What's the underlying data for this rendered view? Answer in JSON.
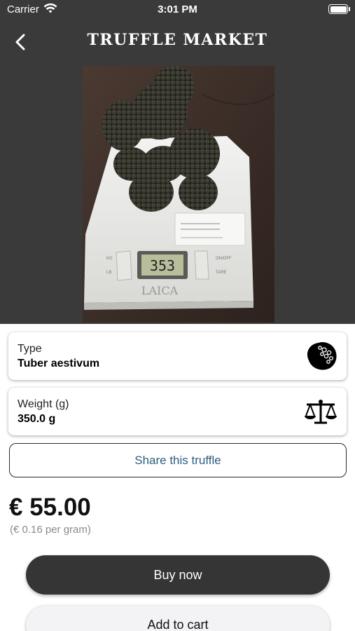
{
  "status_bar": {
    "carrier": "Carrier",
    "time": "3:01 PM",
    "icons": [
      "wifi-icon",
      "battery-icon"
    ]
  },
  "nav": {
    "title": "TRUFFLE MARKET",
    "back_icon": "chevron-left-icon"
  },
  "photo": {
    "scale_brand": "LAICA",
    "scale_display": "353",
    "scale_labels": {
      "left_top": "KG",
      "left_bottom": "LB",
      "right_top": "ON/OFF",
      "right_bottom": "TARE"
    }
  },
  "details": {
    "type_label": "Type",
    "type_value": "Tuber aestivum",
    "type_icon": "truffle-icon",
    "weight_label": "Weight (g)",
    "weight_value": "350.0 g",
    "weight_icon": "scale-balance-icon"
  },
  "share_label": "Share this truffle",
  "price": "€ 55.00",
  "per_gram": "(€ 0.16 per gram)",
  "buy_label": "Buy now",
  "cart_label": "Add to cart",
  "colors": {
    "header_bg": "#3a3a3a",
    "share_text": "#2f5f80",
    "buy_bg": "#353535"
  }
}
